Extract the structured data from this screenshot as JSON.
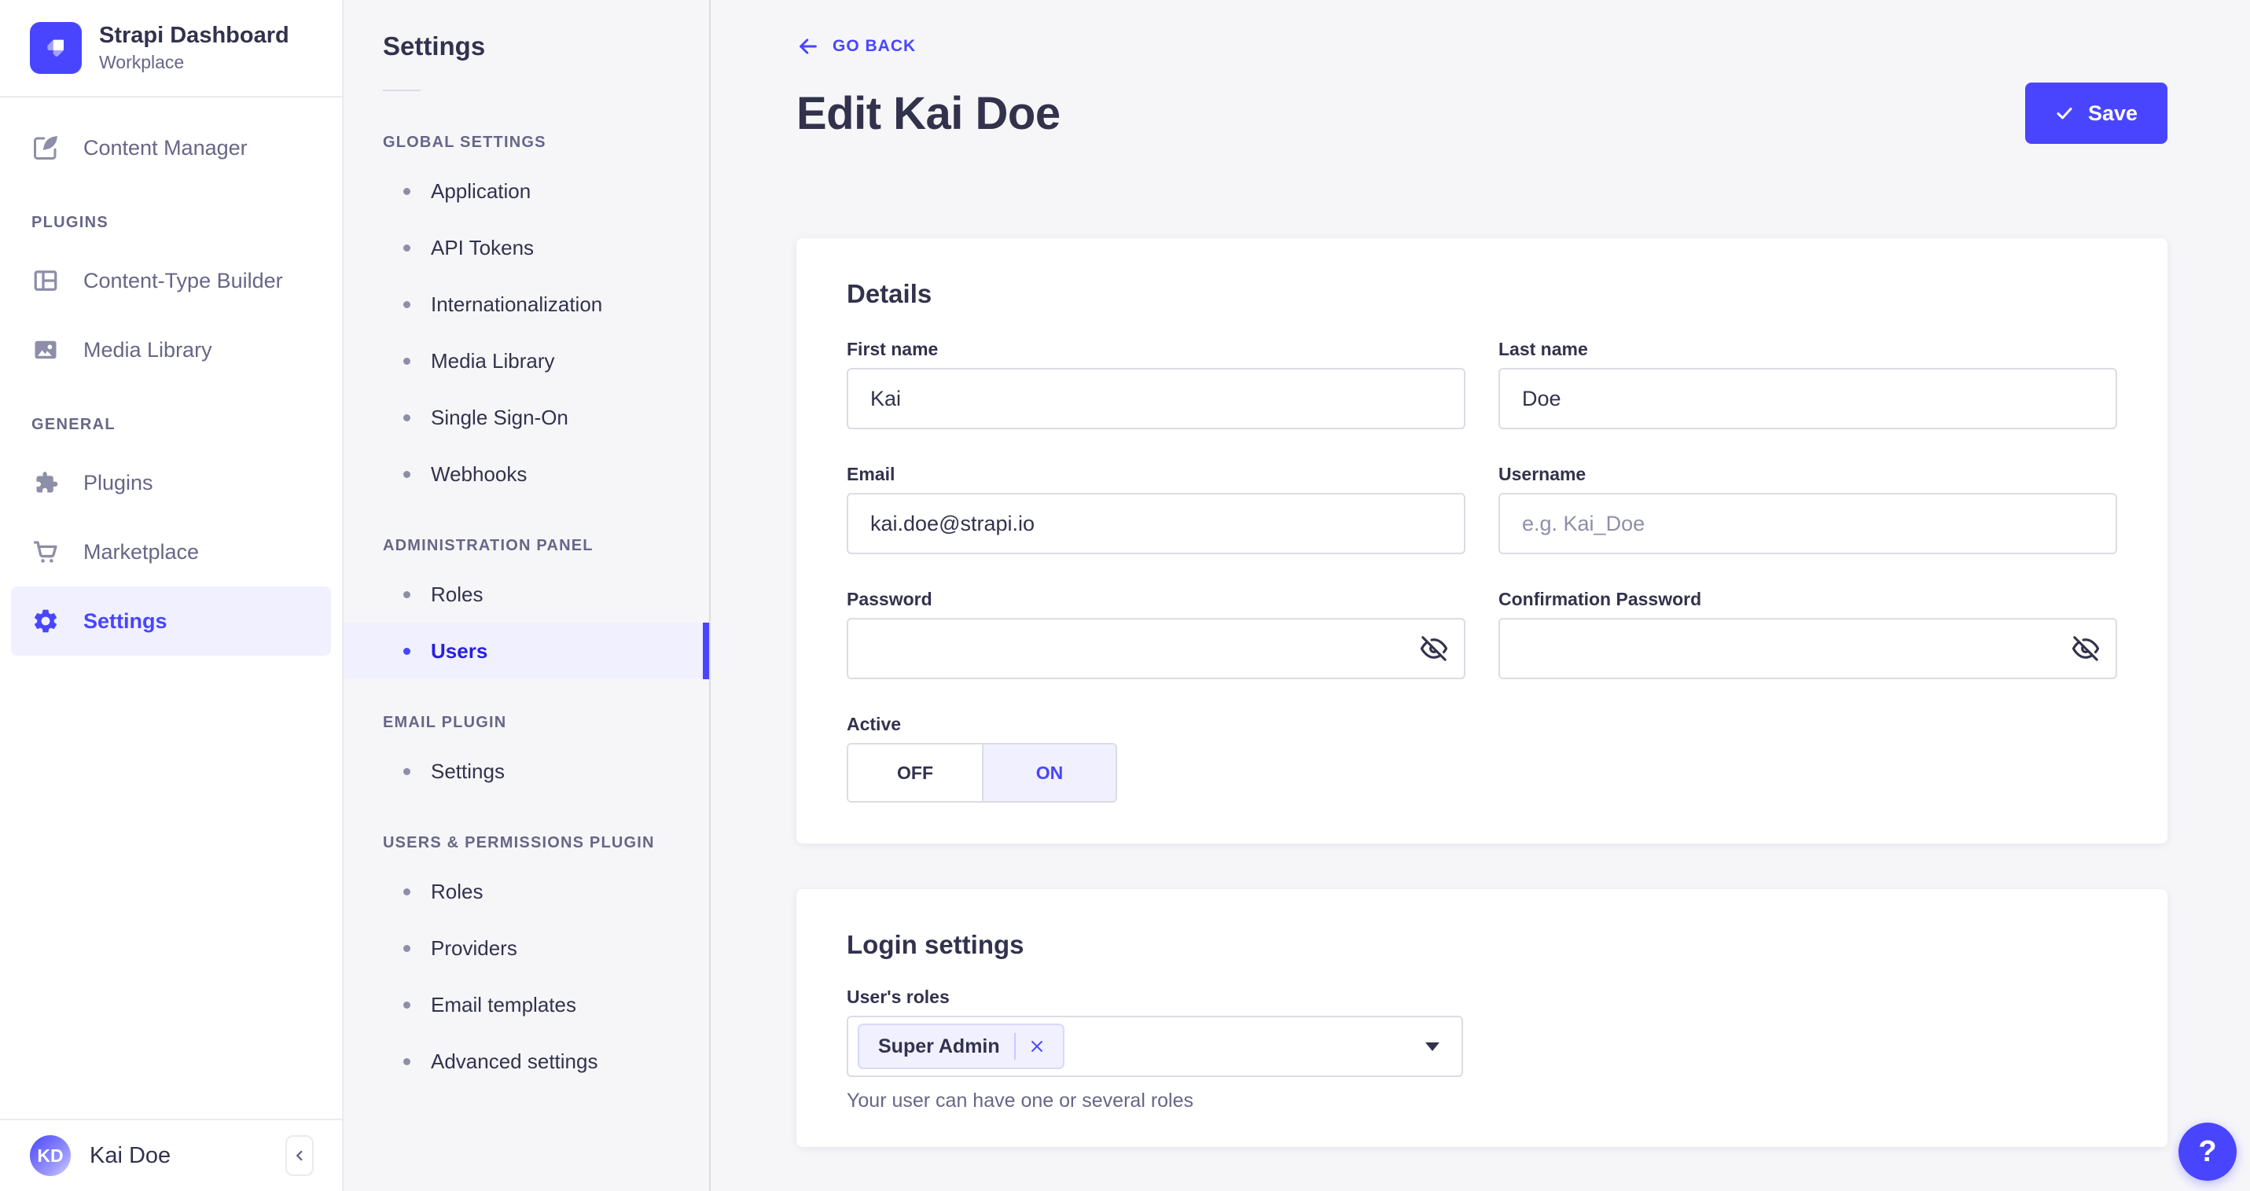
{
  "brand": {
    "title": "Strapi Dashboard",
    "subtitle": "Workplace",
    "logo_icon": "strapi-logo-icon"
  },
  "main_nav": {
    "items_top": [
      {
        "label": "Content Manager",
        "icon": "feather-pen-icon"
      }
    ],
    "sections": [
      {
        "label": "PLUGINS",
        "items": [
          {
            "label": "Content-Type Builder",
            "icon": "layout-grid-icon"
          },
          {
            "label": "Media Library",
            "icon": "picture-icon"
          }
        ]
      },
      {
        "label": "GENERAL",
        "items": [
          {
            "label": "Plugins",
            "icon": "puzzle-icon"
          },
          {
            "label": "Marketplace",
            "icon": "cart-icon"
          },
          {
            "label": "Settings",
            "icon": "gear-icon",
            "active": true
          }
        ]
      }
    ],
    "user": {
      "initials": "KD",
      "name": "Kai Doe"
    },
    "collapse_icon": "chevron-left-icon"
  },
  "sub_nav": {
    "title": "Settings",
    "sections": [
      {
        "label": "GLOBAL SETTINGS",
        "items": [
          {
            "label": "Application"
          },
          {
            "label": "API Tokens"
          },
          {
            "label": "Internationalization"
          },
          {
            "label": "Media Library"
          },
          {
            "label": "Single Sign-On"
          },
          {
            "label": "Webhooks"
          }
        ]
      },
      {
        "label": "ADMINISTRATION PANEL",
        "items": [
          {
            "label": "Roles"
          },
          {
            "label": "Users",
            "active": true
          }
        ]
      },
      {
        "label": "EMAIL PLUGIN",
        "items": [
          {
            "label": "Settings"
          }
        ]
      },
      {
        "label": "USERS & PERMISSIONS PLUGIN",
        "items": [
          {
            "label": "Roles"
          },
          {
            "label": "Providers"
          },
          {
            "label": "Email templates"
          },
          {
            "label": "Advanced settings"
          }
        ]
      }
    ]
  },
  "header": {
    "back_label": "GO BACK",
    "title": "Edit Kai Doe",
    "save_label": "Save"
  },
  "details": {
    "heading": "Details",
    "first_name": {
      "label": "First name",
      "value": "Kai"
    },
    "last_name": {
      "label": "Last name",
      "value": "Doe"
    },
    "email": {
      "label": "Email",
      "value": "kai.doe@strapi.io"
    },
    "username": {
      "label": "Username",
      "placeholder": "e.g. Kai_Doe",
      "value": ""
    },
    "password": {
      "label": "Password",
      "value": ""
    },
    "confirmation_password": {
      "label": "Confirmation Password",
      "value": ""
    },
    "active": {
      "label": "Active",
      "off_label": "OFF",
      "on_label": "ON",
      "value": "ON"
    }
  },
  "login_settings": {
    "heading": "Login settings",
    "roles_label": "User's roles",
    "selected_roles": [
      {
        "name": "Super Admin"
      }
    ],
    "helper_text": "Your user can have one or several roles"
  },
  "help_button": {
    "label": "?"
  },
  "colors": {
    "primary": "#4945ff",
    "primary_active_text": "#271fe0",
    "primary_light": "#f0f0ff",
    "tag_border": "#d9d8ff",
    "text_dark": "#32324d",
    "text_muted": "#666687",
    "placeholder": "#8e8ea9",
    "border": "#dcdce4",
    "background": "#f6f6f9"
  }
}
